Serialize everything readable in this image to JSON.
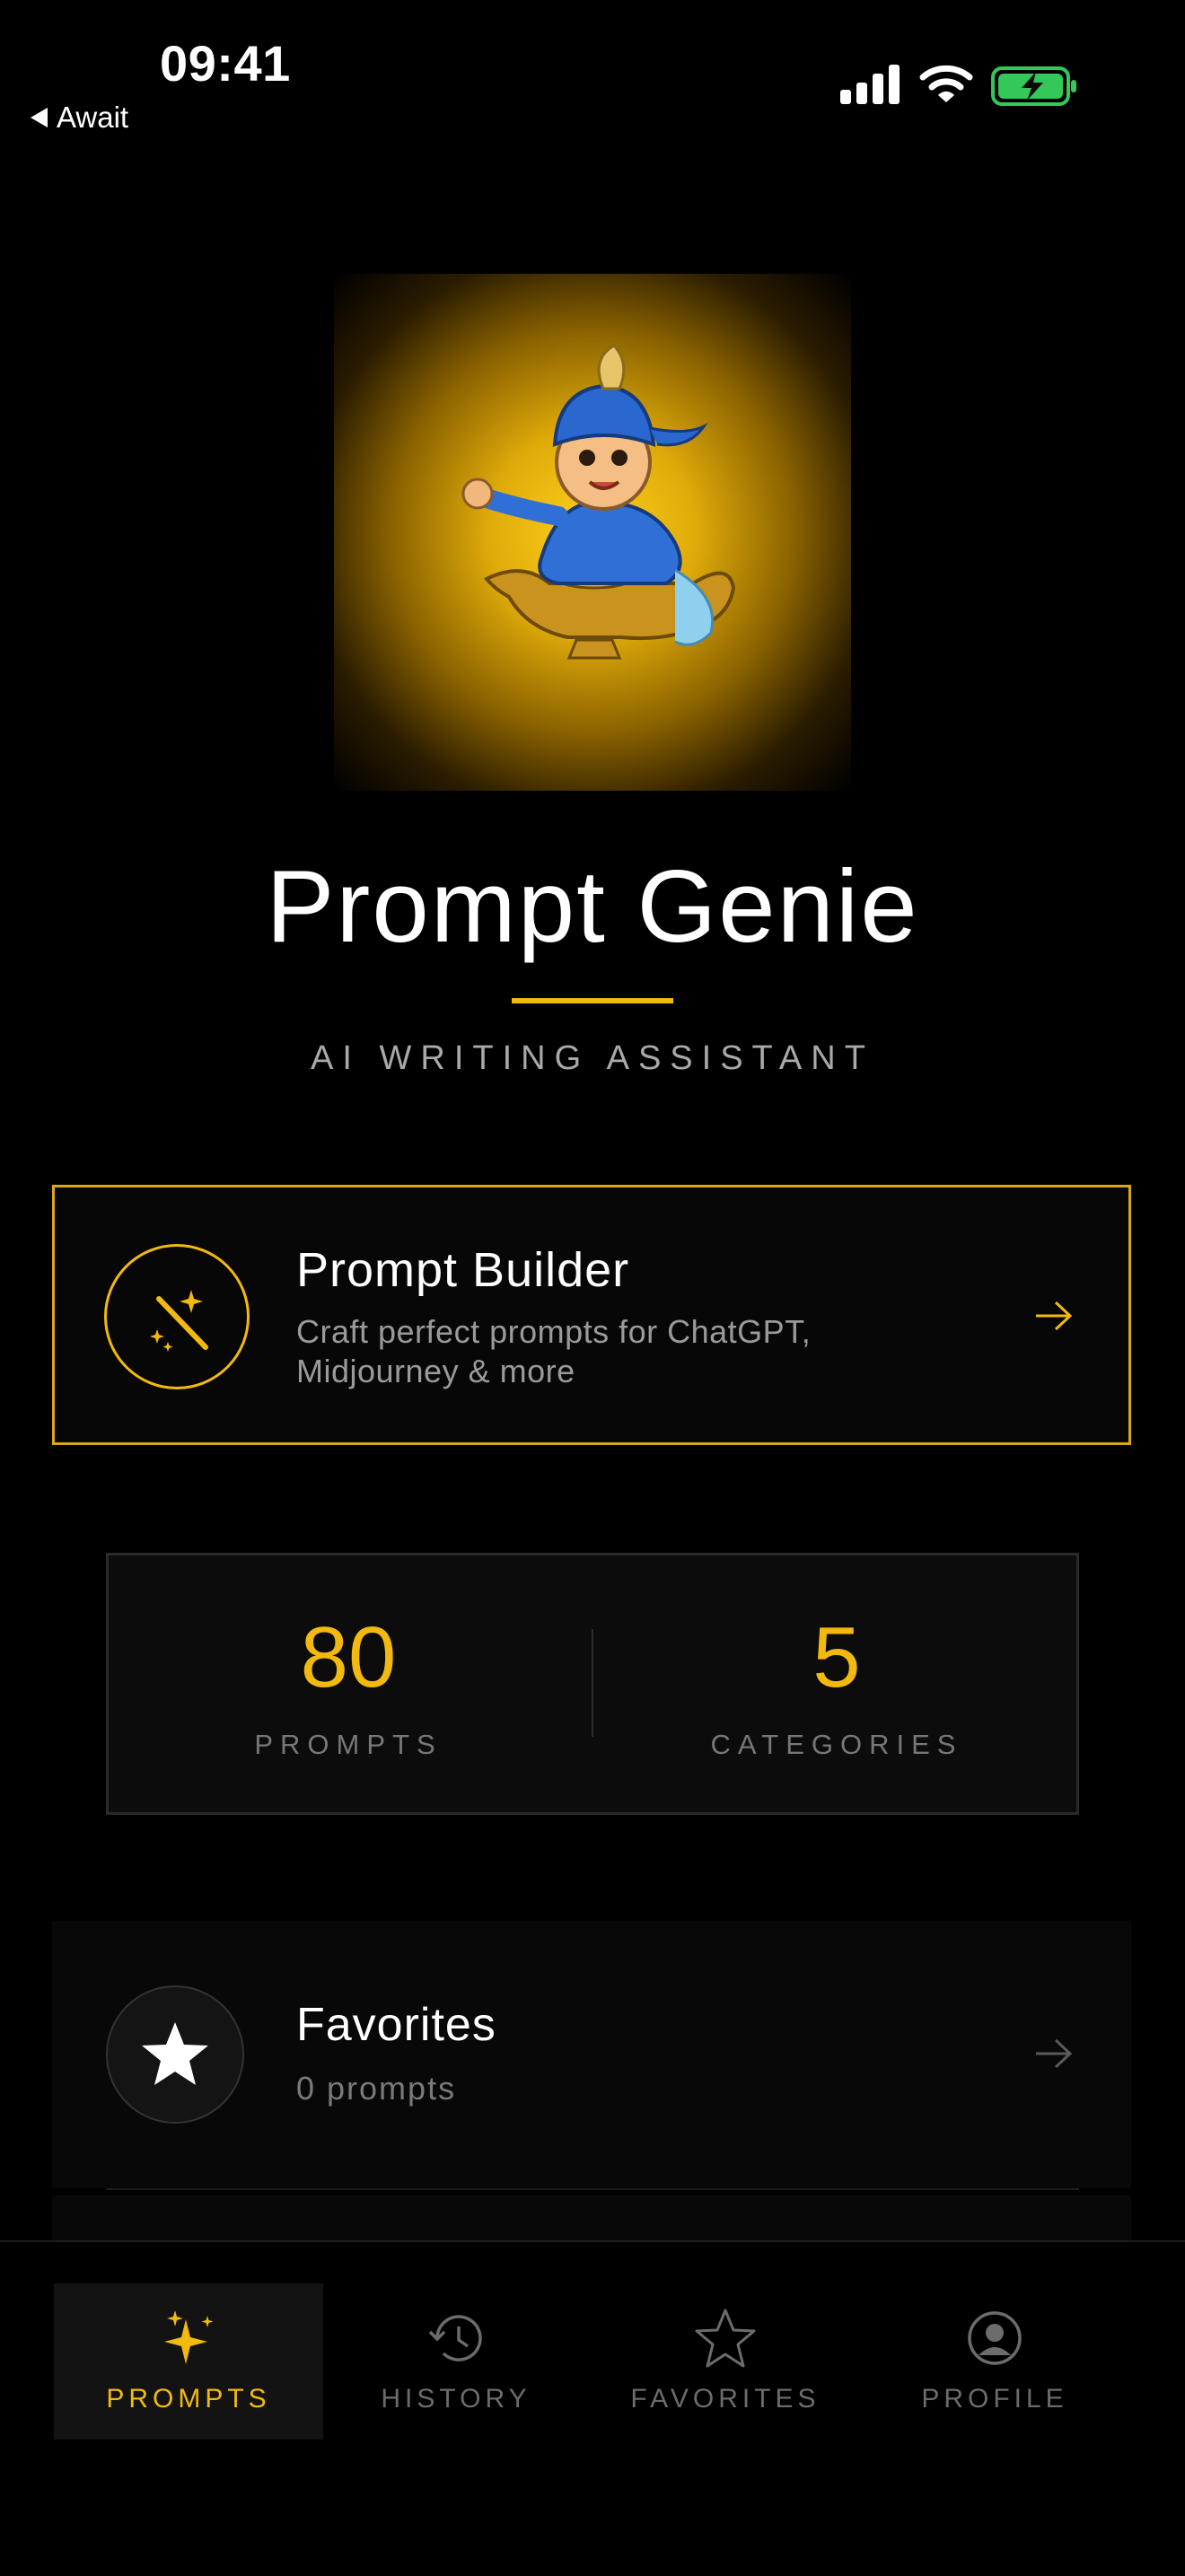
{
  "status_bar": {
    "time": "09:41",
    "back_label": "Await",
    "battery_color": "#34c759"
  },
  "hero": {
    "image": "genie-with-lamp-illustration",
    "title": "Prompt Genie",
    "subtitle": "AI WRITING ASSISTANT",
    "accent_color": "#f2b90f"
  },
  "builder_card": {
    "icon": "magic-wand-icon",
    "title": "Prompt Builder",
    "description": "Craft perfect prompts for ChatGPT, Midjourney & more",
    "arrow_icon": "arrow-right-icon"
  },
  "stats": [
    {
      "value": "80",
      "label": "PROMPTS"
    },
    {
      "value": "5",
      "label": "CATEGORIES"
    }
  ],
  "favorites_card": {
    "icon": "star-icon",
    "title": "Favorites",
    "count": "0 prompts",
    "arrow_icon": "arrow-right-icon"
  },
  "tab_bar": {
    "tabs": [
      {
        "label": "PROMPTS",
        "icon": "sparkles-icon",
        "active": true
      },
      {
        "label": "HISTORY",
        "icon": "history-icon",
        "active": false
      },
      {
        "label": "FAVORITES",
        "icon": "star-outline-icon",
        "active": false
      },
      {
        "label": "PROFILE",
        "icon": "profile-icon",
        "active": false
      }
    ]
  }
}
